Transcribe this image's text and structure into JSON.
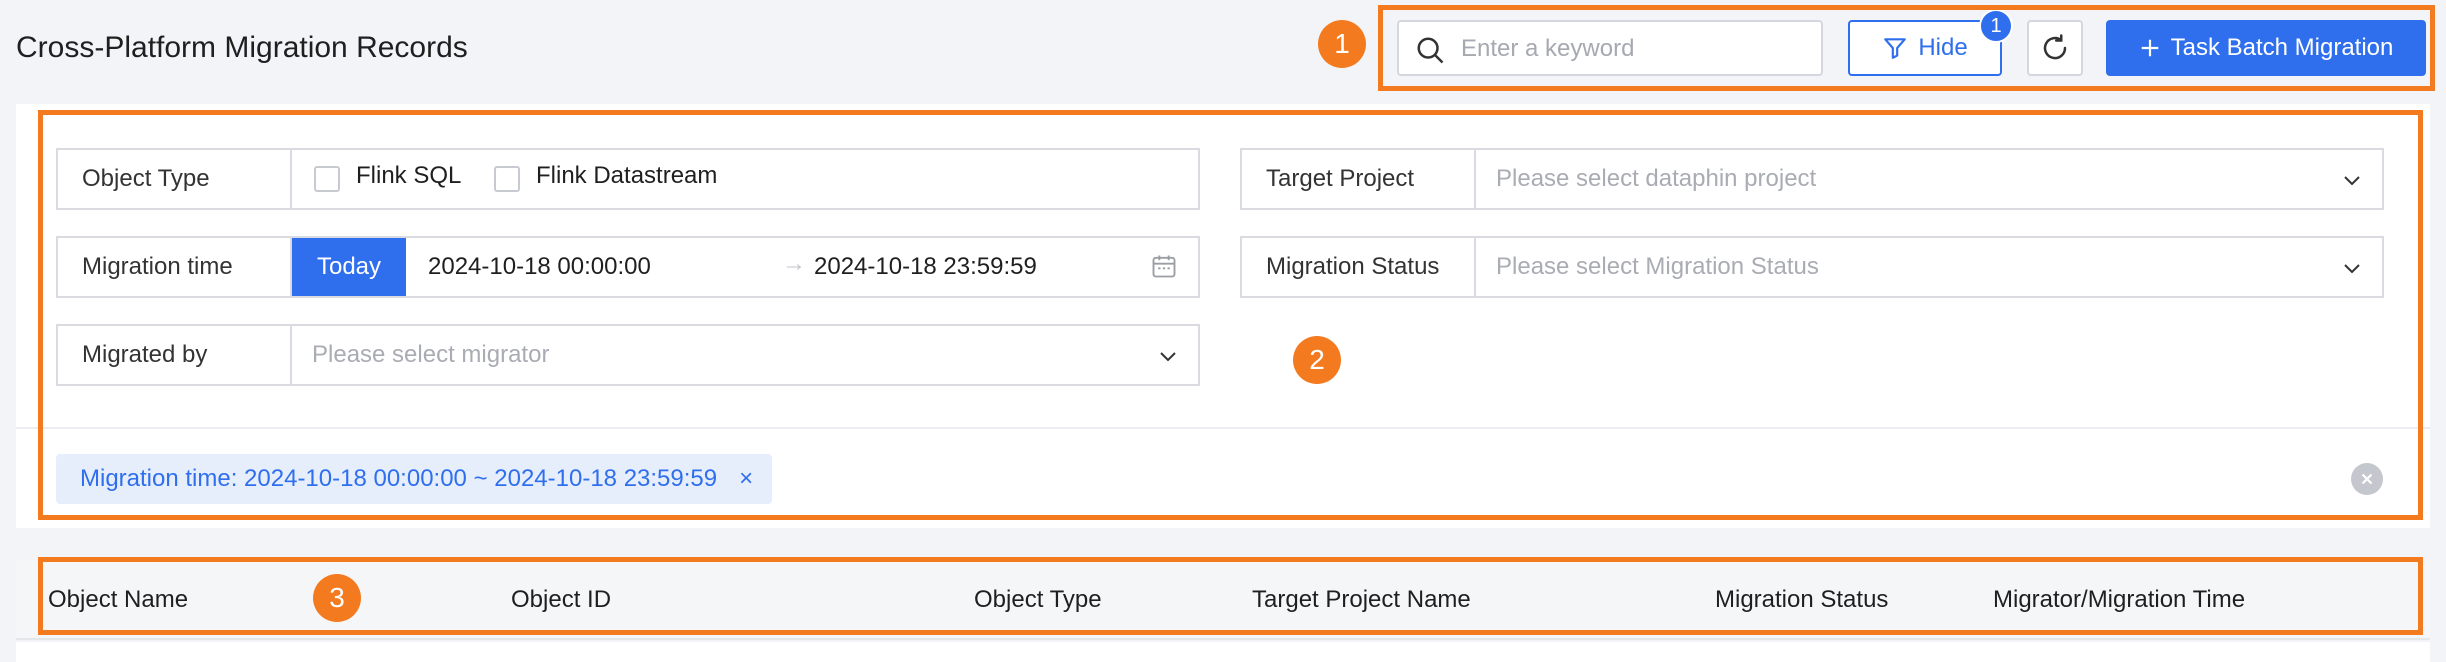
{
  "header": {
    "title": "Cross-Platform Migration Records",
    "search": {
      "value": "",
      "placeholder": "Enter a keyword",
      "icon": "search-icon"
    },
    "hide_button": {
      "label": "Hide",
      "icon": "filter-icon",
      "badge_count": "1"
    },
    "refresh_button": {
      "icon": "refresh-icon"
    },
    "batch_button": {
      "label": "Task Batch Migration",
      "icon": "plus-icon"
    }
  },
  "filters": {
    "object_type": {
      "label": "Object Type",
      "options": [
        {
          "label": "Flink SQL",
          "checked": false
        },
        {
          "label": "Flink Datastream",
          "checked": false
        }
      ]
    },
    "target_project": {
      "label": "Target Project",
      "placeholder": "Please select dataphin project"
    },
    "migration_time": {
      "label": "Migration time",
      "quick_button": "Today",
      "start": "2024-10-18 00:00:00",
      "end": "2024-10-18 23:59:59",
      "separator": "→"
    },
    "migration_status": {
      "label": "Migration Status",
      "placeholder": "Please select Migration Status"
    },
    "migrated_by": {
      "label": "Migrated by",
      "placeholder": "Please select migrator"
    }
  },
  "active_filters": {
    "chips": [
      {
        "label": "Migration time: 2024-10-18 00:00:00 ~ 2024-10-18 23:59:59",
        "close": "×"
      }
    ]
  },
  "table": {
    "columns": [
      "Object Name",
      "Object ID",
      "Object Type",
      "Target Project Name",
      "Migration Status",
      "Migrator/Migration Time"
    ]
  },
  "annotations": [
    "1",
    "2",
    "3"
  ],
  "colors": {
    "primary": "#2f6fed",
    "annotation": "#f47a1f"
  }
}
